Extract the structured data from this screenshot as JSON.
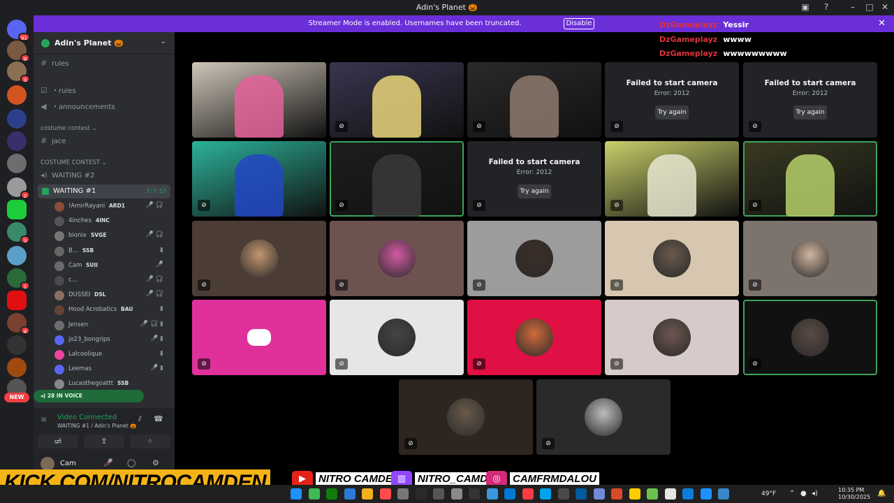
{
  "window": {
    "title": "Adin's Planet 🎃"
  },
  "banner": {
    "message": "Streamer Mode is enabled. Usernames have been truncated.",
    "disable_label": "Disable"
  },
  "server": {
    "name": "Adin's Planet 🎃"
  },
  "channels": {
    "top": [
      {
        "name": "rules"
      }
    ],
    "list": [
      {
        "name": "rules"
      },
      {
        "name": "announcements"
      }
    ],
    "cat1": "costume contest",
    "cat1_channels": [
      {
        "name": "jace"
      }
    ],
    "cat2": "COSTUME CONTEST",
    "voice": [
      {
        "name": "WAITING #2"
      },
      {
        "name": "WAITING #1",
        "timer": "3:7:53"
      }
    ]
  },
  "members": [
    {
      "name": "!AmirRayani",
      "tag": "ARD1",
      "status": "🎤̸ 🎧̸",
      "color": "#8b4c3a"
    },
    {
      "name": "4inches",
      "tag": "4INC",
      "status": "",
      "color": "#555"
    },
    {
      "name": "bionix",
      "tag": "SVGE",
      "status": "🎤̸ 🎧̸",
      "color": "#777"
    },
    {
      "name": "B...",
      "tag": "SSB",
      "status": "▮",
      "color": "#666"
    },
    {
      "name": "Cam",
      "tag": "SUII",
      "status": "🎤̸",
      "color": "#6a6a6a"
    },
    {
      "name": "c...",
      "tag": "",
      "status": "🎤̸ 🎧̸",
      "color": "#4a4a4a"
    },
    {
      "name": "DUSSEI",
      "tag": "DSL",
      "status": "🎤̸ 🎧̸",
      "color": "#8a7060"
    },
    {
      "name": "Hood Acrobatics",
      "tag": "BAU",
      "status": "▮",
      "color": "#664433"
    },
    {
      "name": "Jensen",
      "tag": "",
      "status": "🎤̸ 🎧̸ ▮",
      "color": "#6e6e6e"
    },
    {
      "name": "jo23_bongrips",
      "tag": "",
      "status": "🎤̸ ▮",
      "color": "#5865f2"
    },
    {
      "name": "Lalcoolique",
      "tag": "",
      "status": "▮",
      "color": "#eb459e"
    },
    {
      "name": "Leemas",
      "tag": "",
      "status": "🎤̸ ▮",
      "color": "#5865f2"
    },
    {
      "name": "Lucasthegoattt",
      "tag": "SSB",
      "status": "",
      "color": "#888"
    }
  ],
  "in_voice": {
    "label": "28 IN VOICE"
  },
  "voice_panel": {
    "status": "Video Connected",
    "sub": "WAITING #1 / Adin's Planet 🎃",
    "user": "Cam"
  },
  "chat": [
    {
      "user": "DzGameplayz",
      "text": "Yessir"
    },
    {
      "user": "DzGameplayz",
      "text": "wwww"
    },
    {
      "user": "DzGameplayz",
      "text": "wwwwwwwww"
    }
  ],
  "tiles": [
    {
      "kind": "video",
      "color": "#cfc6b8",
      "accent": "#e3629a"
    },
    {
      "kind": "video",
      "color": "#3a3550",
      "accent": "#e9d67a"
    },
    {
      "kind": "video",
      "color": "#2a2a2a",
      "accent": "#8d7a6d"
    },
    {
      "kind": "fail",
      "title": "Failed to start camera",
      "error": "Error: 2012",
      "button": "Try again"
    },
    {
      "kind": "fail",
      "title": "Failed to start camera",
      "error": "Error: 2012",
      "button": "Try again"
    },
    {
      "kind": "video",
      "color": "#2bb39a",
      "accent": "#2347c4"
    },
    {
      "kind": "video",
      "color": "#1c1f1c",
      "accent": "#3a3a3a",
      "speaking": true
    },
    {
      "kind": "fail",
      "title": "Failed to start camera",
      "error": "Error: 2012",
      "button": "Try again"
    },
    {
      "kind": "video",
      "color": "#c9cf6a",
      "accent": "#e6e6d0"
    },
    {
      "kind": "video",
      "color": "#3a3a22",
      "accent": "#b6d06a",
      "speaking": true
    },
    {
      "kind": "avatar",
      "color": "#4b3c35",
      "accent": "#c2966e"
    },
    {
      "kind": "avatar",
      "color": "#6c5350",
      "accent": "#d25aa2"
    },
    {
      "kind": "avatar",
      "color": "#9c9c9c",
      "accent": "#3b2e26"
    },
    {
      "kind": "avatar",
      "color": "#d8c7b0",
      "accent": "#6a5a4c"
    },
    {
      "kind": "avatar",
      "color": "#7d736d",
      "accent": "#d0b5a0"
    },
    {
      "kind": "discord",
      "color": "#e0319b",
      "accent": "#ffffff"
    },
    {
      "kind": "avatar",
      "color": "#e6e6e6",
      "accent": "#444"
    },
    {
      "kind": "avatar",
      "color": "#e01044",
      "accent": "#d06a3a"
    },
    {
      "kind": "avatar",
      "color": "#d6cbc8",
      "accent": "#6e5750"
    },
    {
      "kind": "avatar",
      "color": "#111111",
      "accent": "#5a4a44",
      "speaking": true
    },
    {
      "kind": "avatar",
      "color": "#2e2420",
      "accent": "#6a5a4a"
    },
    {
      "kind": "avatar",
      "color": "#2a2a2a",
      "accent": "#bdbdbd"
    }
  ],
  "overlay": {
    "kick": "KICK.COM/NITROCAMDEN",
    "youtube": "NITRO CAMDEN",
    "twitch": "NITRO_CAMDEN",
    "instagram": "CAMFRMDALOU"
  },
  "taskbar": {
    "weather": "49°F",
    "time": "10:35 PM",
    "date": "10/30/2025"
  },
  "colors": {
    "accent": "#5865f2",
    "banner": "#6a2fd8",
    "speaking": "#3ba55c",
    "kick": "#f4b317"
  }
}
